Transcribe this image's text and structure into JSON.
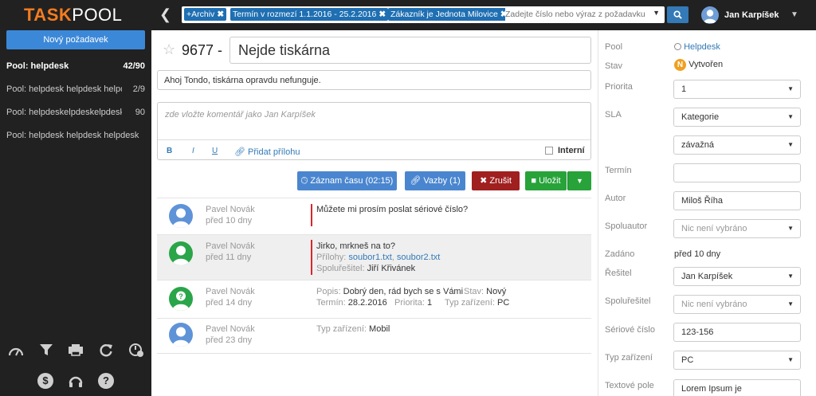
{
  "app": {
    "logo_part1": "TASK",
    "logo_part2": "POOL"
  },
  "topbar": {
    "filters": [
      "+Archiv",
      "Termín v rozmezí 1.1.2016 - 25.2.2016",
      "Zákazník je Jednota Milovice"
    ],
    "search_placeholder": "Zadejte číslo nebo výraz z požadavku",
    "user_name": "Jan Karpíšek"
  },
  "sidebar": {
    "new_request_label": "Nový požadavek",
    "pools": [
      {
        "label": "Pool: helpdesk",
        "count": "42/90"
      },
      {
        "label": "Pool: helpdesk helpdesk helpdesk",
        "count": "2/9"
      },
      {
        "label": "Pool: helpdeskelpdeskelpdeskelpdesk",
        "count": "90"
      },
      {
        "label": "Pool: helpdesk helpdesk helpdesk helpdesk",
        "count": ""
      }
    ]
  },
  "ticket": {
    "id": "9677 -",
    "title": "Nejde tiskárna",
    "description": "Ahoj Tondo, tiskárna opravdu nefunguje.",
    "comment_placeholder": "zde vložte komentář jako Jan Karpíšek",
    "tools": {
      "bold": "B",
      "italic": "I",
      "underline": "U",
      "attach": "Přidat přílohu"
    },
    "internal_label": "Interní",
    "buttons": {
      "time": "Záznam času (02:15)",
      "links": "Vazby (1)",
      "cancel": "Zrušit",
      "save": "Uložit"
    }
  },
  "history": [
    {
      "author": "Pavel Novák",
      "time": "před 10 dny",
      "text": "Můžete mi prosím poslat sériové číslo?"
    },
    {
      "author": "Pavel Novák",
      "time": "před 11 dny",
      "text": "Jirko, mrkneš na to?",
      "attach_label": "Přílohy:",
      "attachments": [
        "soubor1.txt",
        "soubor2.txt"
      ],
      "cosolver_label": "Spoluřešitel:",
      "cosolver": "Jiří Křivánek"
    },
    {
      "author": "Pavel Novák",
      "time": "před 14 dny",
      "popis_label": "Popis:",
      "popis": "Dobrý den, rád bych se s Vámi",
      "stav_label": "Stav:",
      "stav": "Nový",
      "termin_label": "Termín:",
      "termin": "28.2.2016",
      "priorita_label": "Priorita:",
      "priorita": "1",
      "typ_label": "Typ zařízení:",
      "typ": "PC"
    },
    {
      "author": "Pavel Novák",
      "time": "před 23 dny",
      "typ_label": "Typ zařízení:",
      "typ": "Mobil"
    }
  ],
  "fields": {
    "pool": {
      "label": "Pool",
      "value": "Helpdesk"
    },
    "stav": {
      "label": "Stav",
      "badge": "N",
      "value": "Vytvořen"
    },
    "priorita": {
      "label": "Priorita",
      "value": "1"
    },
    "sla": {
      "label": "SLA",
      "value1": "Kategorie",
      "value2": "závažná"
    },
    "termin": {
      "label": "Termín",
      "value": ""
    },
    "autor": {
      "label": "Autor",
      "value": "Miloš Říha"
    },
    "spoluautor": {
      "label": "Spoluautor",
      "value": "Nic není vybráno"
    },
    "zadano": {
      "label": "Zadáno",
      "value": "před 10 dny"
    },
    "resitel": {
      "label": "Řešitel",
      "value": "Jan Karpíšek"
    },
    "spoluresitel": {
      "label": "Spoluřešitel",
      "value": "Nic není vybráno"
    },
    "seriove": {
      "label": "Sériové číslo",
      "value": "123-156"
    },
    "typ": {
      "label": "Typ zařízení",
      "value": "PC"
    },
    "textove": {
      "label": "Textové pole",
      "value": "Lorem Ipsum je"
    }
  },
  "colors": {
    "accent": "#f47c20",
    "primary": "#337ab7",
    "danger": "#a01f1f",
    "success": "#27a33a",
    "dark": "#212121"
  }
}
